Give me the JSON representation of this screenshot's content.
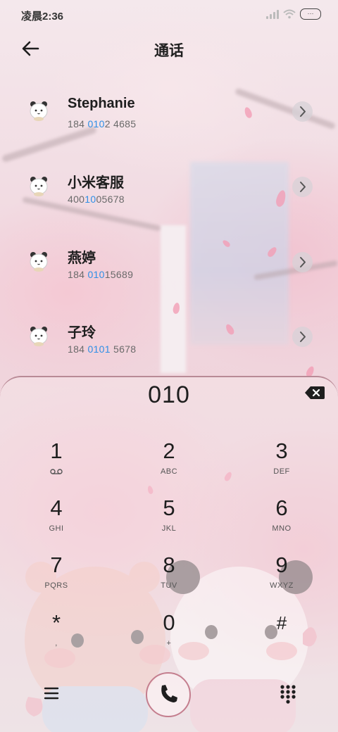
{
  "status_bar": {
    "time": "凌晨2:36"
  },
  "header": {
    "title": "通话"
  },
  "contacts": [
    {
      "name": "Stephanie",
      "phone": [
        {
          "t": "184 ",
          "hl": false
        },
        {
          "t": "010",
          "hl": true
        },
        {
          "t": "2 4685",
          "hl": false
        }
      ]
    },
    {
      "name": "小米客服",
      "phone": [
        {
          "t": "400",
          "hl": false
        },
        {
          "t": "10",
          "hl": true
        },
        {
          "t": "05678",
          "hl": false
        }
      ]
    },
    {
      "name": "燕婷",
      "phone": [
        {
          "t": "184 ",
          "hl": false
        },
        {
          "t": "010",
          "hl": true
        },
        {
          "t": "15689",
          "hl": false
        }
      ]
    },
    {
      "name": "子玲",
      "phone": [
        {
          "t": "184 ",
          "hl": false
        },
        {
          "t": "0101",
          "hl": true
        },
        {
          "t": " 5678",
          "hl": false
        }
      ]
    }
  ],
  "dialpad": {
    "number": "010",
    "keys": [
      {
        "digit": "1",
        "letters": ""
      },
      {
        "digit": "2",
        "letters": "ABC"
      },
      {
        "digit": "3",
        "letters": "DEF"
      },
      {
        "digit": "4",
        "letters": "GHI"
      },
      {
        "digit": "5",
        "letters": "JKL"
      },
      {
        "digit": "6",
        "letters": "MNO"
      },
      {
        "digit": "7",
        "letters": "PQRS"
      },
      {
        "digit": "8",
        "letters": "TUV"
      },
      {
        "digit": "9",
        "letters": "WXYZ"
      },
      {
        "digit": "*",
        "letters": ","
      },
      {
        "digit": "0",
        "letters": "+"
      },
      {
        "digit": "#",
        "letters": ""
      }
    ]
  },
  "icons": {
    "back": "arrow-left-icon",
    "chevron": "chevron-right-icon",
    "backspace": "backspace-icon",
    "voicemail": "voicemail-icon",
    "menu": "menu-icon",
    "call": "phone-icon",
    "keypad": "keypad-icon"
  },
  "colors": {
    "highlight": "#2f8fe6",
    "accent_pink": "#c47e8e"
  }
}
